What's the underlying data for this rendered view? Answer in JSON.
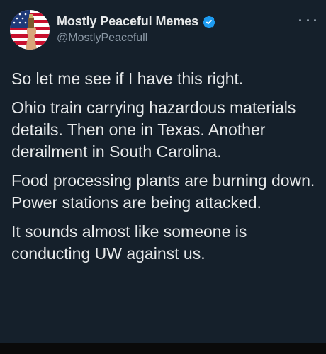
{
  "tweet": {
    "author": {
      "display_name": "Mostly Peaceful Memes",
      "handle": "@MostlyPeacefull",
      "verified": true,
      "avatar_icon": "flag-fist-avatar"
    },
    "menu_icon": "more-dots-icon",
    "paragraphs": [
      "So let me see if I have this right.",
      "Ohio train carrying hazardous materials details. Then one in Texas. Another derailment in South Carolina.",
      "Food processing plants are burning down. Power stations are being attacked.",
      "It sounds almost like someone is conducting UW against us."
    ]
  },
  "colors": {
    "background": "#15202b",
    "text": "#e7e9ea",
    "secondary_text": "#8b98a5",
    "verified_badge": "#1d9bf0"
  }
}
